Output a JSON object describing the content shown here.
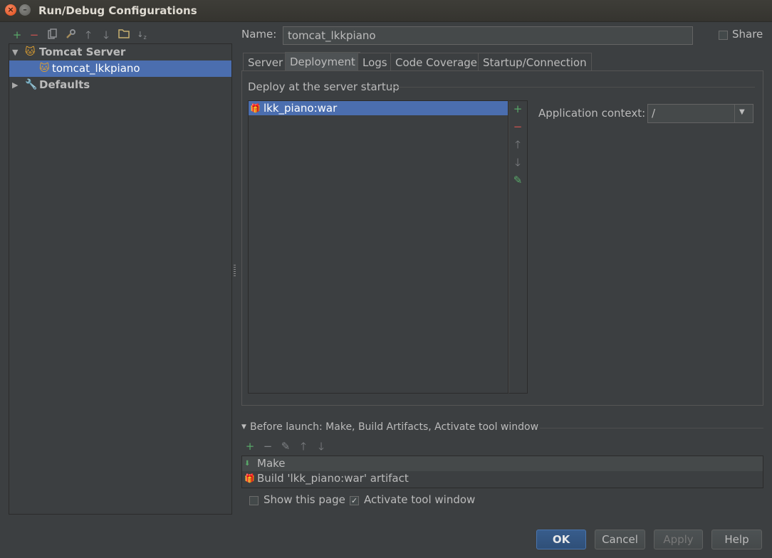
{
  "window": {
    "title": "Run/Debug Configurations"
  },
  "tree": {
    "items": [
      {
        "label": "Tomcat Server",
        "icon": "tomcat-icon",
        "expanded": true
      },
      {
        "label": "tomcat_lkkpiano",
        "icon": "tomcat-config-icon",
        "selected": true
      },
      {
        "label": "Defaults",
        "icon": "wrench-icon",
        "expanded": false
      }
    ]
  },
  "config": {
    "name_label": "Name:",
    "name_value": "tomcat_lkkpiano",
    "share_label": "Share",
    "share_checked": false
  },
  "tabs": [
    {
      "label": "Server"
    },
    {
      "label": "Deployment",
      "active": true
    },
    {
      "label": "Logs"
    },
    {
      "label": "Code Coverage"
    },
    {
      "label": "Startup/Connection"
    }
  ],
  "deployment": {
    "section_title": "Deploy at the server startup",
    "items": [
      {
        "label": "lkk_piano:war",
        "icon": "artifact-icon",
        "selected": true
      }
    ],
    "context_label": "Application context:",
    "context_value": "/"
  },
  "before_launch": {
    "title": "Before launch: Make, Build Artifacts, Activate tool window",
    "tasks": [
      {
        "label": "Make",
        "icon": "make-icon"
      },
      {
        "label": "Build 'lkk_piano:war' artifact",
        "icon": "artifact-icon"
      }
    ],
    "show_page_label": "Show this page",
    "show_page_checked": false,
    "activate_label": "Activate tool window",
    "activate_checked": true
  },
  "buttons": {
    "ok": "OK",
    "cancel": "Cancel",
    "apply": "Apply",
    "help": "Help"
  },
  "colors": {
    "background": "#3c3f41",
    "selection": "#4b6eaf",
    "add_green": "#59a869",
    "remove_red": "#c75450"
  }
}
